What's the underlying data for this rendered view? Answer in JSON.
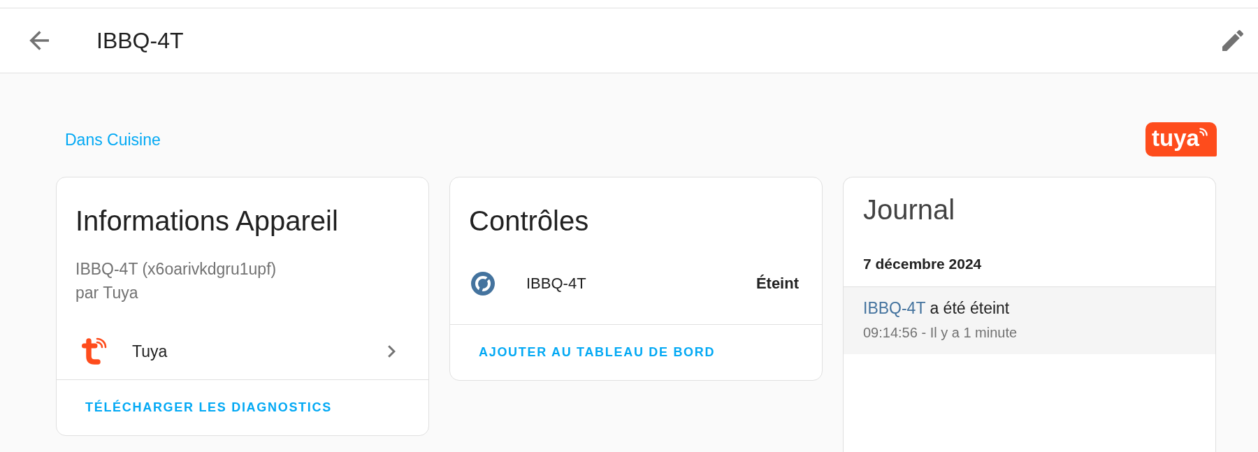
{
  "header": {
    "title": "IBBQ-4T"
  },
  "area_link": "Dans Cuisine",
  "brand_logo": {
    "text": "tuya"
  },
  "device_info_card": {
    "title": "Informations Appareil",
    "model": "IBBQ-4T (x6oarivkdgru1upf)",
    "manufacturer": "par Tuya",
    "integrations": [
      {
        "name": "Tuya"
      }
    ],
    "action": "TÉLÉCHARGER LES DIAGNOSTICS"
  },
  "controls_card": {
    "title": "Contrôles",
    "entities": [
      {
        "name": "IBBQ-4T",
        "state": "Éteint"
      }
    ],
    "action": "AJOUTER AU TABLEAU DE BORD"
  },
  "logbook_card": {
    "title": "Journal",
    "days": [
      {
        "date": "7 décembre 2024",
        "entries": [
          {
            "entity": "IBBQ-4T",
            "message": "a été éteint",
            "time": "09:14:56 - Il y a 1 minute"
          }
        ]
      }
    ]
  }
}
